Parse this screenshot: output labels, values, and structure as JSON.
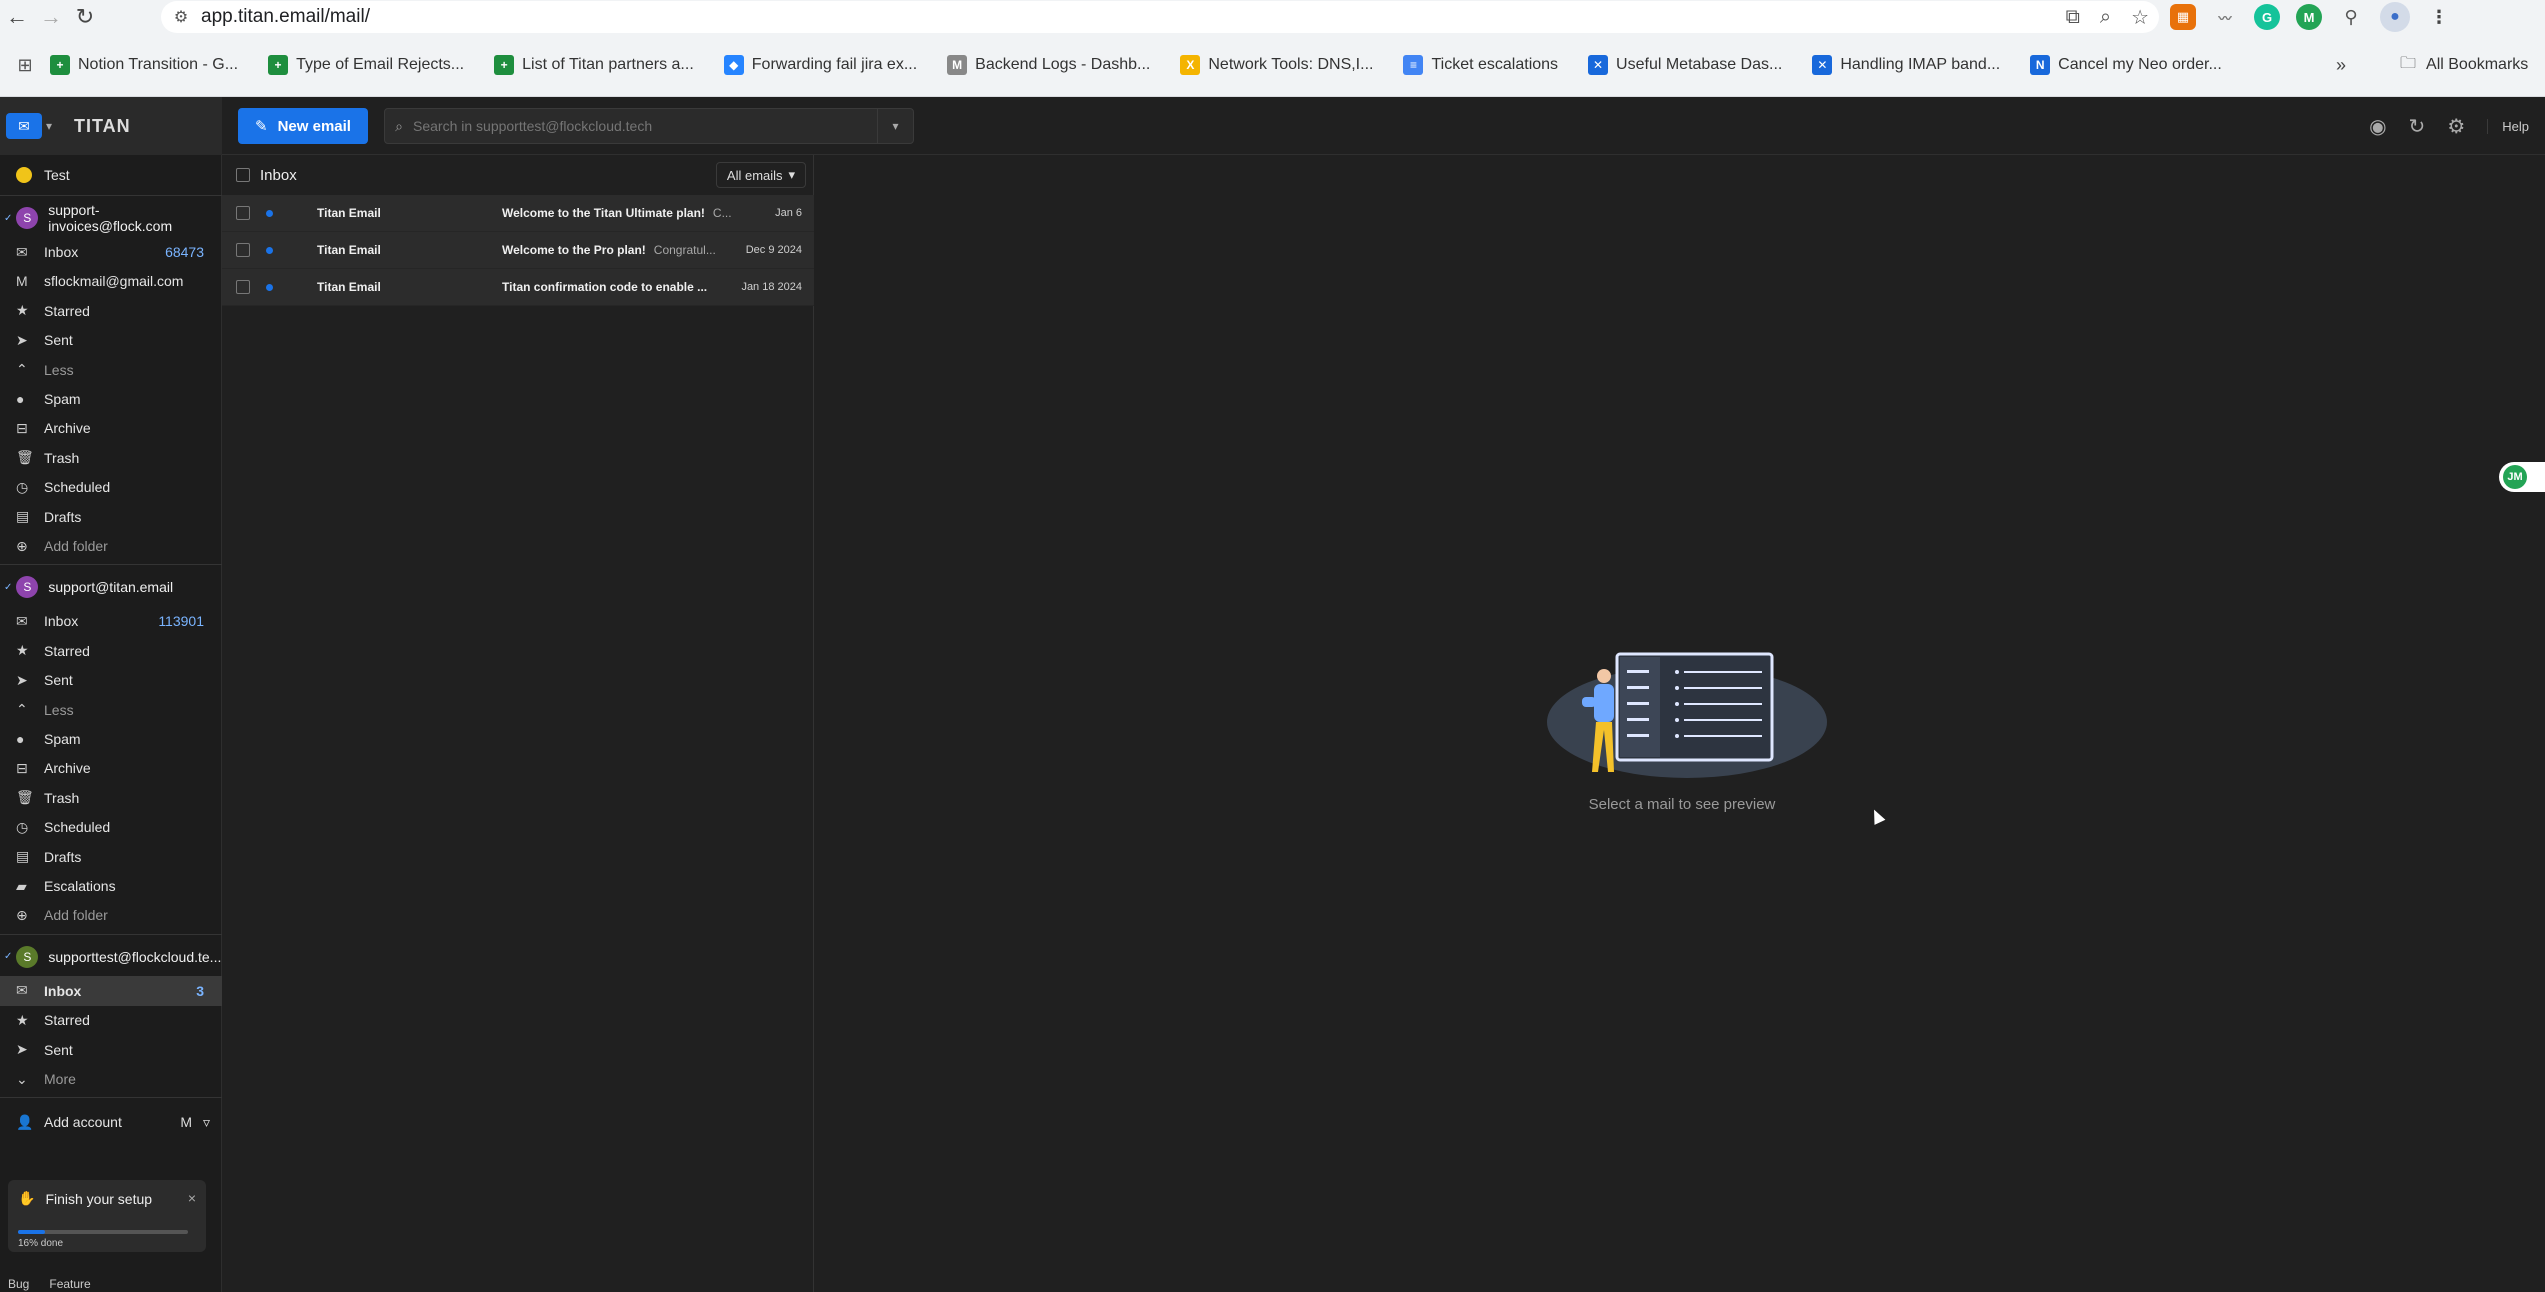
{
  "browser": {
    "url": "app.titan.email/mail/",
    "bookmarks": [
      {
        "label": "Notion Transition - G...",
        "color": "#1e8e3e",
        "glyph": "+"
      },
      {
        "label": "Type of Email Rejects...",
        "color": "#1e8e3e",
        "glyph": "+"
      },
      {
        "label": "List of Titan partners a...",
        "color": "#1e8e3e",
        "glyph": "+"
      },
      {
        "label": "Forwarding fail jira ex...",
        "color": "#2684ff",
        "glyph": "◆"
      },
      {
        "label": "Backend Logs - Dashb...",
        "color": "#888888",
        "glyph": "M"
      },
      {
        "label": "Network Tools: DNS,I...",
        "color": "#f4b400",
        "glyph": "X"
      },
      {
        "label": "Ticket escalations",
        "color": "#4285f4",
        "glyph": "≡"
      },
      {
        "label": "Useful Metabase Das...",
        "color": "#1868db",
        "glyph": "✕"
      },
      {
        "label": "Handling IMAP band...",
        "color": "#1868db",
        "glyph": "✕"
      },
      {
        "label": "Cancel my Neo order...",
        "color": "#1868db",
        "glyph": "N"
      }
    ],
    "all_bookmarks": "All Bookmarks"
  },
  "app": {
    "logo": "TITAN",
    "new_email": "New email",
    "search_placeholder": "Search in supporttest@flockcloud.tech",
    "help": "Help"
  },
  "sidebar": {
    "tag": "Test",
    "accounts": [
      {
        "email": "support-invoices@flock.com",
        "avatar": "S",
        "avatar_color": "#8e44ad",
        "folders": [
          {
            "label": "Inbox",
            "count": "68473",
            "icon": "inbox-icon"
          },
          {
            "label": "sflockmail@gmail.com",
            "icon": "gmail-icon"
          },
          {
            "label": "Starred",
            "icon": "star-icon"
          },
          {
            "label": "Sent",
            "icon": "send-icon"
          },
          {
            "label": "Less",
            "icon": "chevron-up-icon"
          },
          {
            "label": "Spam",
            "icon": "spam-icon"
          },
          {
            "label": "Archive",
            "icon": "archive-icon"
          },
          {
            "label": "Trash",
            "icon": "trash-icon"
          },
          {
            "label": "Scheduled",
            "icon": "clock-icon"
          },
          {
            "label": "Drafts",
            "icon": "draft-icon"
          },
          {
            "label": "Add folder",
            "icon": "add-folder-icon"
          }
        ]
      },
      {
        "email": "support@titan.email",
        "avatar": "S",
        "avatar_color": "#8e44ad",
        "folders": [
          {
            "label": "Inbox",
            "count": "113901",
            "icon": "inbox-icon"
          },
          {
            "label": "Starred",
            "icon": "star-icon"
          },
          {
            "label": "Sent",
            "icon": "send-icon"
          },
          {
            "label": "Less",
            "icon": "chevron-up-icon"
          },
          {
            "label": "Spam",
            "icon": "spam-icon"
          },
          {
            "label": "Archive",
            "icon": "archive-icon"
          },
          {
            "label": "Trash",
            "icon": "trash-icon"
          },
          {
            "label": "Scheduled",
            "icon": "clock-icon"
          },
          {
            "label": "Drafts",
            "icon": "draft-icon"
          },
          {
            "label": "Escalations",
            "icon": "folder-icon"
          },
          {
            "label": "Add folder",
            "icon": "add-folder-icon"
          }
        ]
      },
      {
        "email": "supporttest@flockcloud.te...",
        "avatar": "S",
        "avatar_color": "#5a7a2a",
        "folders": [
          {
            "label": "Inbox",
            "count": "3",
            "icon": "inbox-icon",
            "active": true
          },
          {
            "label": "Starred",
            "icon": "star-icon"
          },
          {
            "label": "Sent",
            "icon": "send-icon"
          },
          {
            "label": "More",
            "icon": "chevron-down-icon"
          }
        ]
      }
    ],
    "add_account": "Add account",
    "setup": {
      "title": "Finish your setup",
      "progress_percent": 16,
      "progress_label": "16% done"
    },
    "bottom_links": [
      "Bug",
      "Feature"
    ]
  },
  "list": {
    "title": "Inbox",
    "filter": "All emails",
    "emails": [
      {
        "from": "Titan Email",
        "subject": "Welcome to the Titan Ultimate plan!",
        "preview": "C...",
        "date": "Jan 6"
      },
      {
        "from": "Titan Email",
        "subject": "Welcome to the Pro plan!",
        "preview": "Congratul...",
        "date": "Dec 9 2024"
      },
      {
        "from": "Titan Email",
        "subject": "Titan confirmation code to enable ...",
        "preview": "",
        "date": "Jan 18 2024"
      }
    ]
  },
  "preview": {
    "empty_text": "Select a mail to see preview",
    "floating_avatar": "JM"
  }
}
